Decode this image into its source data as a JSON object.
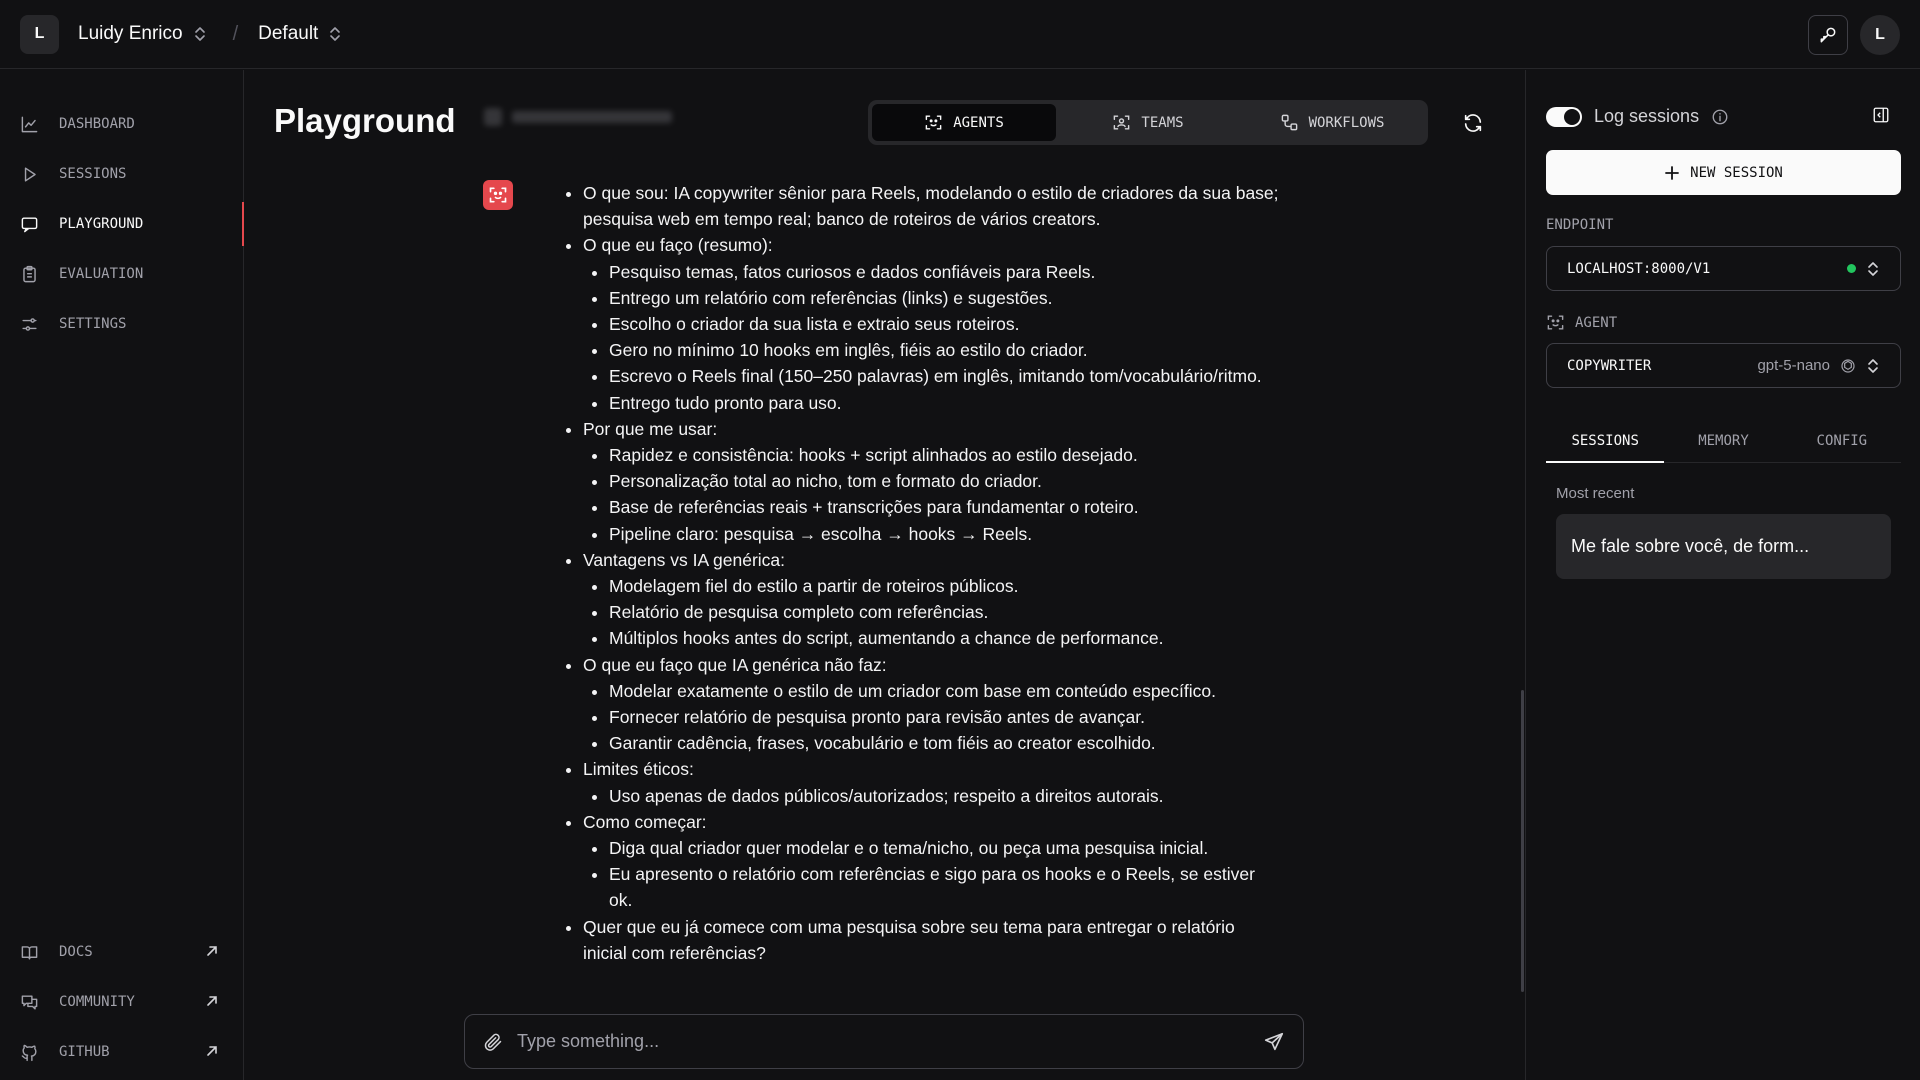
{
  "workspace": {
    "avatar_letter": "L",
    "user_name": "Luidy Enrico",
    "project": "Default"
  },
  "header": {
    "user_avatar_letter": "L"
  },
  "sidebar": {
    "items": [
      {
        "label": "DASHBOARD",
        "icon": "chart-line-icon"
      },
      {
        "label": "SESSIONS",
        "icon": "play-icon"
      },
      {
        "label": "PLAYGROUND",
        "icon": "chat-icon"
      },
      {
        "label": "EVALUATION",
        "icon": "clipboard-icon"
      },
      {
        "label": "SETTINGS",
        "icon": "sliders-icon"
      }
    ],
    "active_index": 2,
    "footer_links": [
      {
        "label": "DOCS",
        "icon": "book-icon"
      },
      {
        "label": "COMMUNITY",
        "icon": "chat-bubbles-icon"
      },
      {
        "label": "GITHUB",
        "icon": "github-icon"
      }
    ]
  },
  "main": {
    "title": "Playground",
    "modes": [
      {
        "label": "AGENTS",
        "icon": "agent-icon"
      },
      {
        "label": "TEAMS",
        "icon": "team-icon"
      },
      {
        "label": "WORKFLOWS",
        "icon": "workflow-icon"
      }
    ],
    "active_mode": 0,
    "message": [
      {
        "text": "O que sou: IA copywriter sênior para Reels, modelando o estilo de criadores da sua base; pesquisa web em tempo real; banco de roteiros de vários creators.",
        "children": []
      },
      {
        "text": "O que eu faço (resumo):",
        "children": [
          "Pesquiso temas, fatos curiosos e dados confiáveis para Reels.",
          "Entrego um relatório com referências (links) e sugestões.",
          "Escolho o criador da sua lista e extraio seus roteiros.",
          "Gero no mínimo 10 hooks em inglês, fiéis ao estilo do criador.",
          "Escrevo o Reels final (150–250 palavras) em inglês, imitando tom/vocabulário/ritmo.",
          "Entrego tudo pronto para uso."
        ]
      },
      {
        "text": "Por que me usar:",
        "children": [
          "Rapidez e consistência: hooks + script alinhados ao estilo desejado.",
          "Personalização total ao nicho, tom e formato do criador.",
          "Base de referências reais + transcrições para fundamentar o roteiro.",
          "Pipeline claro: pesquisa → escolha → hooks → Reels."
        ]
      },
      {
        "text": "Vantagens vs IA genérica:",
        "children": [
          "Modelagem fiel do estilo a partir de roteiros públicos.",
          "Relatório de pesquisa completo com referências.",
          "Múltiplos hooks antes do script, aumentando a chance de performance."
        ]
      },
      {
        "text": "O que eu faço que IA genérica não faz:",
        "children": [
          "Modelar exatamente o estilo de um criador com base em conteúdo específico.",
          "Fornecer relatório de pesquisa pronto para revisão antes de avançar.",
          "Garantir cadência, frases, vocabulário e tom fiéis ao creator escolhido."
        ]
      },
      {
        "text": "Limites éticos:",
        "children": [
          "Uso apenas de dados públicos/autorizados; respeito a direitos autorais."
        ]
      },
      {
        "text": "Como começar:",
        "children": [
          "Diga qual criador quer modelar e o tema/nicho, ou peça uma pesquisa inicial.",
          "Eu apresento o relatório com referências e sigo para os hooks e o Reels, se estiver ok."
        ]
      },
      {
        "text": "Quer que eu já comece com uma pesquisa sobre seu tema para entregar o relatório inicial com referências?",
        "children": []
      }
    ],
    "input_placeholder": "Type something..."
  },
  "right_panel": {
    "log_sessions_label": "Log sessions",
    "new_session_label": "NEW SESSION",
    "endpoint_label": "ENDPOINT",
    "endpoint_value": "LOCALHOST:8000/V1",
    "agent_label": "AGENT",
    "agent_value": "COPYWRITER",
    "model_value": "gpt-5-nano",
    "tabs": [
      "SESSIONS",
      "MEMORY",
      "CONFIG"
    ],
    "active_tab": 0,
    "most_recent_label": "Most recent",
    "sessions": [
      "Me fale sobre você, de form..."
    ]
  },
  "colors": {
    "accent": "#e5484d",
    "status_ok": "#22c55e",
    "background": "#111113"
  }
}
